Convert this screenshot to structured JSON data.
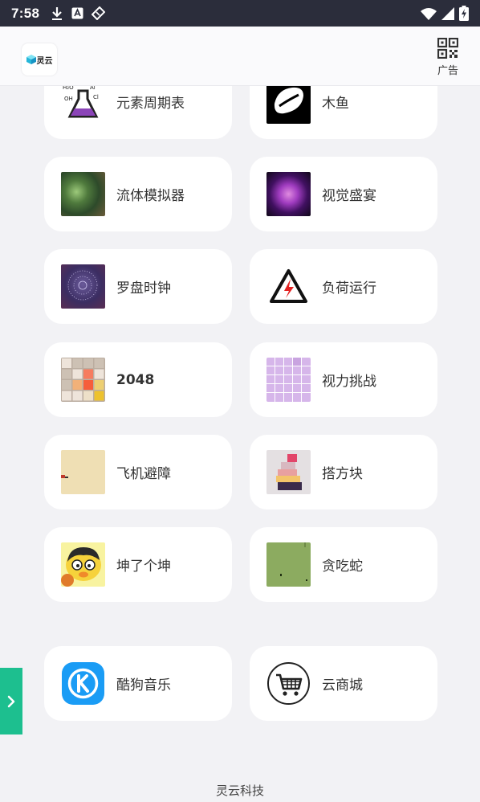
{
  "status_bar": {
    "time": "7:58"
  },
  "header": {
    "ad_label": "广告",
    "logo_text": "灵云"
  },
  "apps": [
    {
      "label": "元素周期表",
      "icon": "chemistry-flask-icon"
    },
    {
      "label": "木鱼",
      "icon": "wooden-fish-icon"
    },
    {
      "label": "流体模拟器",
      "icon": "fluid-simulator-icon"
    },
    {
      "label": "视觉盛宴",
      "icon": "visual-feast-icon"
    },
    {
      "label": "罗盘时钟",
      "icon": "compass-clock-icon"
    },
    {
      "label": "负荷运行",
      "icon": "high-voltage-warning-icon"
    },
    {
      "label": "2048",
      "icon": "2048-grid-icon"
    },
    {
      "label": "视力挑战",
      "icon": "color-grid-icon"
    },
    {
      "label": "飞机避障",
      "icon": "plane-avoid-icon"
    },
    {
      "label": "搭方块",
      "icon": "stack-blocks-icon"
    },
    {
      "label": "坤了个坤",
      "icon": "cartoon-chick-icon"
    },
    {
      "label": "贪吃蛇",
      "icon": "snake-game-icon"
    },
    {
      "label": "酷狗音乐",
      "icon": "kugou-music-icon"
    },
    {
      "label": "云商城",
      "icon": "shopping-cart-icon"
    }
  ],
  "footer": {
    "brand": "灵云科技"
  },
  "colors": {
    "accent": "#1dbf8f",
    "status_bar": "#2b2d3b",
    "kugou_blue": "#1a9cf5"
  }
}
